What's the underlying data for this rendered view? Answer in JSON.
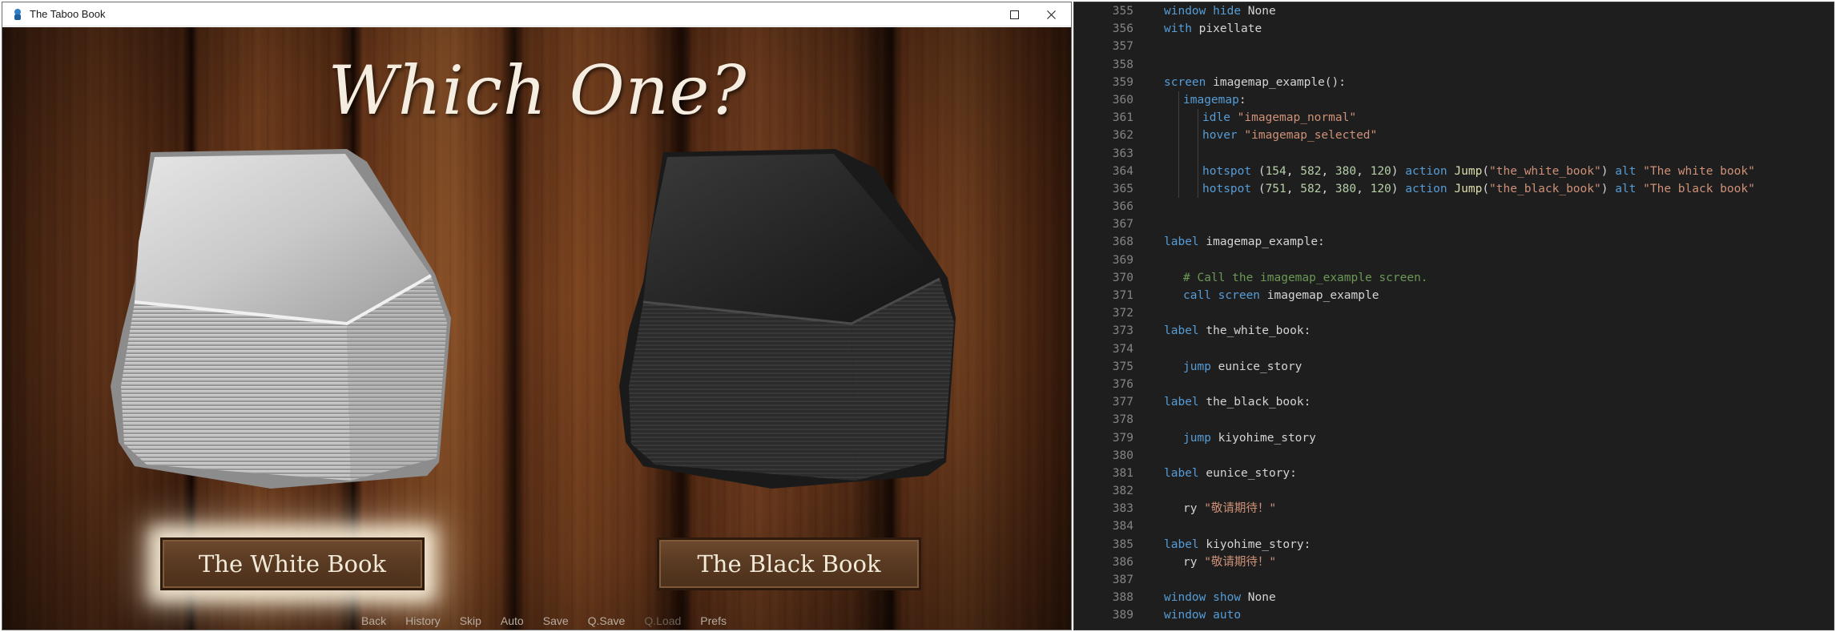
{
  "game_window": {
    "title": "The Taboo Book",
    "heading": "Which One?",
    "choices": [
      {
        "label": "The White Book",
        "highlighted": true
      },
      {
        "label": "The Black Book",
        "highlighted": false
      }
    ],
    "quick_menu": [
      "Back",
      "History",
      "Skip",
      "Auto",
      "Save",
      "Q.Save",
      "Q.Load",
      "Prefs"
    ],
    "quick_menu_disabled": [
      "Q.Load"
    ]
  },
  "editor": {
    "lines": [
      {
        "n": "355",
        "indent": 1,
        "text": "window hide None"
      },
      {
        "n": "356",
        "indent": 1,
        "text": "with pixellate"
      },
      {
        "n": "357",
        "indent": 0,
        "text": ""
      },
      {
        "n": "358",
        "indent": 0,
        "text": ""
      },
      {
        "n": "359",
        "indent": 1,
        "text": "screen imagemap_example():"
      },
      {
        "n": "360",
        "indent": 2,
        "text": "imagemap:"
      },
      {
        "n": "361",
        "indent": 3,
        "text": "idle \"imagemap_normal\""
      },
      {
        "n": "362",
        "indent": 3,
        "text": "hover \"imagemap_selected\""
      },
      {
        "n": "363",
        "indent": 0,
        "text": ""
      },
      {
        "n": "364",
        "indent": 3,
        "text": "hotspot (154, 582, 380, 120) action Jump(\"the_white_book\") alt \"The white book\""
      },
      {
        "n": "365",
        "indent": 3,
        "text": "hotspot (751, 582, 380, 120) action Jump(\"the_black_book\") alt \"The black book\""
      },
      {
        "n": "366",
        "indent": 0,
        "text": ""
      },
      {
        "n": "367",
        "indent": 0,
        "text": ""
      },
      {
        "n": "368",
        "indent": 1,
        "text": "label imagemap_example:"
      },
      {
        "n": "369",
        "indent": 0,
        "text": ""
      },
      {
        "n": "370",
        "indent": 2,
        "text": "# Call the imagemap_example screen."
      },
      {
        "n": "371",
        "indent": 2,
        "text": "call screen imagemap_example"
      },
      {
        "n": "372",
        "indent": 0,
        "text": ""
      },
      {
        "n": "373",
        "indent": 1,
        "text": "label the_white_book:"
      },
      {
        "n": "374",
        "indent": 0,
        "text": ""
      },
      {
        "n": "375",
        "indent": 2,
        "text": "jump eunice_story"
      },
      {
        "n": "376",
        "indent": 0,
        "text": ""
      },
      {
        "n": "377",
        "indent": 1,
        "text": "label the_black_book:"
      },
      {
        "n": "378",
        "indent": 0,
        "text": ""
      },
      {
        "n": "379",
        "indent": 2,
        "text": "jump kiyohime_story"
      },
      {
        "n": "380",
        "indent": 0,
        "text": ""
      },
      {
        "n": "381",
        "indent": 1,
        "text": "label eunice_story:"
      },
      {
        "n": "382",
        "indent": 0,
        "text": ""
      },
      {
        "n": "383",
        "indent": 2,
        "text": "ry \"敬请期待！\""
      },
      {
        "n": "384",
        "indent": 0,
        "text": ""
      },
      {
        "n": "385",
        "indent": 1,
        "text": "label kiyohime_story:"
      },
      {
        "n": "386",
        "indent": 2,
        "text": "ry \"敬请期待！\""
      },
      {
        "n": "387",
        "indent": 0,
        "text": ""
      },
      {
        "n": "388",
        "indent": 1,
        "text": "window show None"
      },
      {
        "n": "389",
        "indent": 1,
        "text": "window auto"
      }
    ]
  },
  "colors": {
    "keyword": "#569cd6",
    "string": "#ce9178",
    "number": "#b5cea8",
    "comment": "#6a9955",
    "function": "#dcdcaa",
    "editor_bg": "#1e1e1e"
  }
}
